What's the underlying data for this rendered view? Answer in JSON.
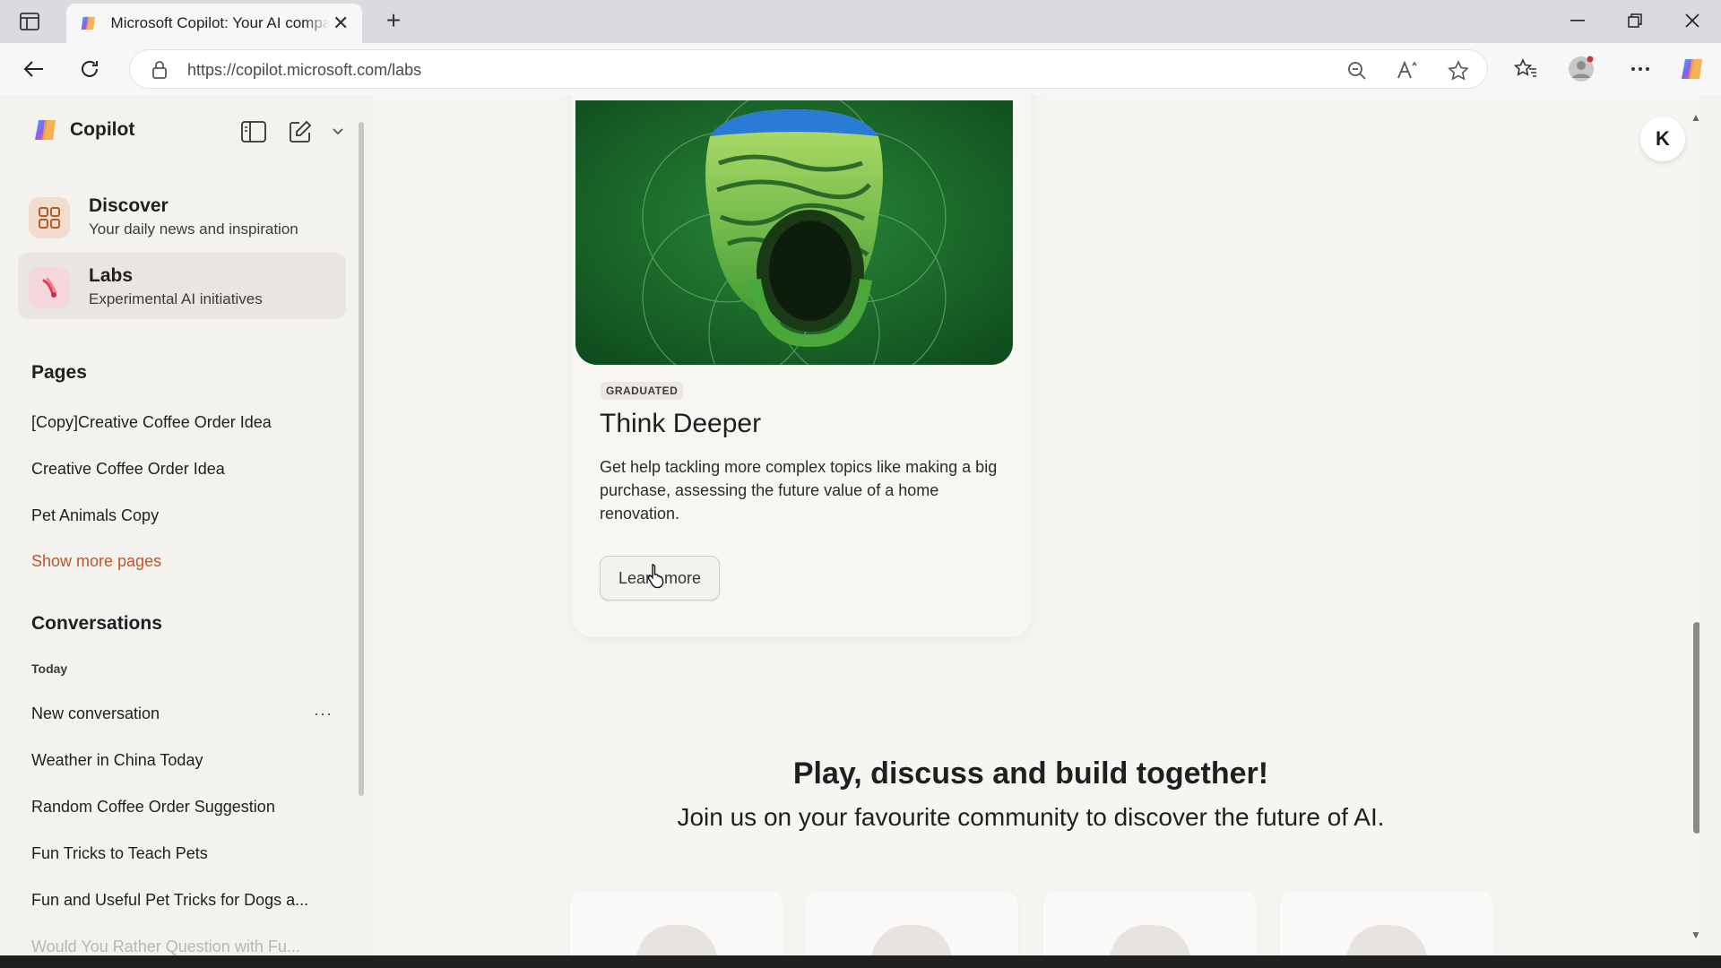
{
  "browser": {
    "tab_title": "Microsoft Copilot: Your AI companion",
    "close_glyph": "✕",
    "newtab_glyph": "+",
    "url": "https://copilot.microsoft.com/labs"
  },
  "sidebar": {
    "brand": "Copilot",
    "nav": [
      {
        "title": "Discover",
        "subtitle": "Your daily news and inspiration"
      },
      {
        "title": "Labs",
        "subtitle": "Experimental AI initiatives"
      }
    ],
    "pages_heading": "Pages",
    "pages": [
      "[Copy]Creative Coffee Order Idea",
      "Creative Coffee Order Idea",
      "Pet Animals Copy"
    ],
    "show_more": "Show more pages",
    "conversations_heading": "Conversations",
    "today_label": "Today",
    "conversations": [
      "New conversation",
      "Weather in China Today",
      "Random Coffee Order Suggestion",
      "Fun Tricks to Teach Pets",
      "Fun and Useful Pet Tricks for Dogs a...",
      "Would You Rather Question with Fu..."
    ],
    "more_glyph": "···"
  },
  "main": {
    "avatar_initial": "K",
    "card": {
      "badge": "GRADUATED",
      "title": "Think Deeper",
      "description": "Get help tackling more complex topics like making a big purchase, assessing the future value of a home renovation.",
      "button": "Learn more"
    },
    "community": {
      "title": "Play, discuss and build together!",
      "subtitle": "Join us on your favourite community to discover the future of AI."
    }
  },
  "colors": {
    "accent_link": "#c0542a",
    "hero_green": "#1b6a2a",
    "sidebar_bg": "#f4f2ef"
  }
}
